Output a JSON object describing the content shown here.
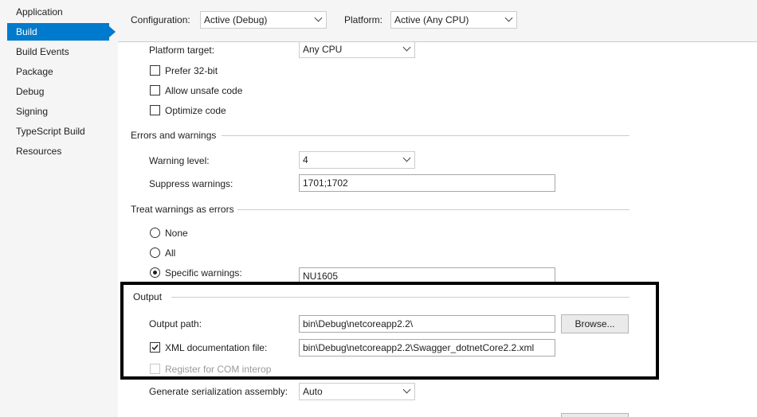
{
  "sidebar": {
    "items": [
      {
        "label": "Application"
      },
      {
        "label": "Build"
      },
      {
        "label": "Build Events"
      },
      {
        "label": "Package"
      },
      {
        "label": "Debug"
      },
      {
        "label": "Signing"
      },
      {
        "label": "TypeScript Build"
      },
      {
        "label": "Resources"
      }
    ],
    "active": "Build"
  },
  "header": {
    "configuration_label": "Configuration:",
    "configuration_value": "Active (Debug)",
    "platform_label": "Platform:",
    "platform_value": "Active (Any CPU)"
  },
  "general": {
    "platform_target_label": "Platform target:",
    "platform_target_value": "Any CPU",
    "prefer32_label": "Prefer 32-bit",
    "prefer32_checked": false,
    "unsafe_label": "Allow unsafe code",
    "unsafe_checked": false,
    "optimize_label": "Optimize code",
    "optimize_checked": false
  },
  "errors": {
    "section_title": "Errors and warnings",
    "warning_level_label": "Warning level:",
    "warning_level_value": "4",
    "suppress_label": "Suppress warnings:",
    "suppress_value": "1701;1702"
  },
  "treat": {
    "section_title": "Treat warnings as errors",
    "none_label": "None",
    "all_label": "All",
    "specific_label": "Specific warnings:",
    "selected": "specific",
    "specific_value": "NU1605"
  },
  "output": {
    "section_title": "Output",
    "path_label": "Output path:",
    "path_value": "bin\\Debug\\netcoreapp2.2\\",
    "browse_label": "Browse...",
    "xml_label": "XML documentation file:",
    "xml_checked": true,
    "xml_value": "bin\\Debug\\netcoreapp2.2\\Swagger_dotnetCore2.2.xml",
    "com_label": "Register for COM interop",
    "com_checked": false,
    "serialization_label": "Generate serialization assembly:",
    "serialization_value": "Auto"
  },
  "colors": {
    "accent": "#007acc",
    "highlight_border": "#000000"
  }
}
